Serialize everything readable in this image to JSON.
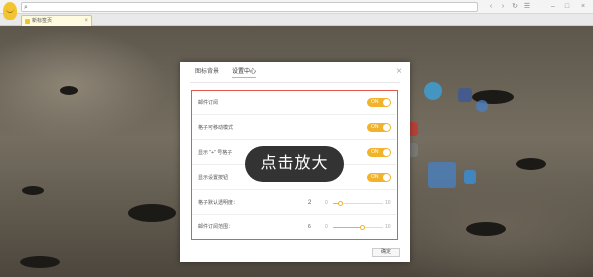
{
  "browser": {
    "address_icon": "search-icon",
    "tab_title": "新标签页",
    "tab_close": "×",
    "new_tab": "+",
    "nav": {
      "back": "‹",
      "forward": "›",
      "refresh": "↻",
      "menu": "☰",
      "minimize": "–",
      "maximize": "□",
      "close": "×"
    }
  },
  "dialog": {
    "tabs": [
      "图标背景",
      "设置中心"
    ],
    "active_tab": "设置中心",
    "close": "×",
    "rows": [
      {
        "label": "邮件订阅",
        "type": "toggle",
        "value": "ON"
      },
      {
        "label": "格子可移动模式",
        "type": "toggle",
        "value": "ON"
      },
      {
        "label": "显示 \"+\" 号格子",
        "type": "toggle",
        "value": "ON"
      },
      {
        "label": "显示设置按钮",
        "type": "toggle",
        "value": "ON"
      },
      {
        "label": "格子默认透明度：",
        "type": "slider",
        "value": "2",
        "min": "0",
        "max": "10",
        "level": 0.15
      },
      {
        "label": "邮件订阅范围：",
        "type": "slider",
        "value": "6",
        "min": "0",
        "max": "10",
        "level": 0.6
      }
    ],
    "ok_label": "确定"
  },
  "zoom_label": "点击放大",
  "colors": {
    "accent": "#f0b32b",
    "highlight_border": "#e05a4e",
    "pill": "#333333"
  }
}
